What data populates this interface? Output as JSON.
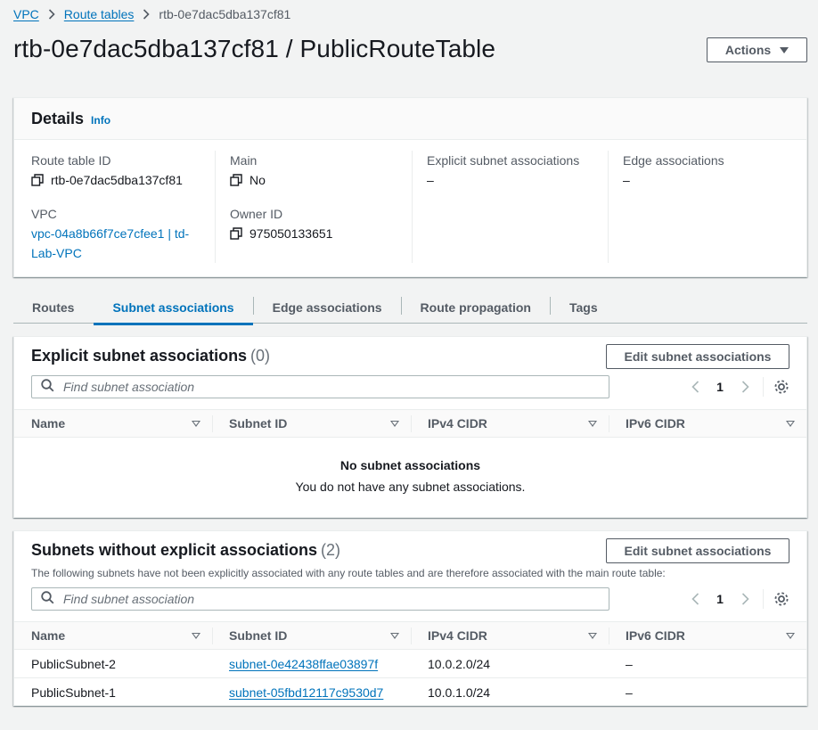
{
  "breadcrumb": {
    "items": [
      "VPC",
      "Route tables"
    ],
    "current": "rtb-0e7dac5dba137cf81"
  },
  "page": {
    "title": "rtb-0e7dac5dba137cf81 / PublicRouteTable",
    "actions_label": "Actions"
  },
  "details": {
    "title": "Details",
    "info": "Info",
    "route_table_id_label": "Route table ID",
    "route_table_id": "rtb-0e7dac5dba137cf81",
    "vpc_label": "VPC",
    "vpc_line1": "vpc-04a8b66f7ce7cfee1 | td-",
    "vpc_line2": "Lab-VPC",
    "main_label": "Main",
    "main_value": "No",
    "owner_label": "Owner ID",
    "owner_value": "975050133651",
    "explicit_label": "Explicit subnet associations",
    "explicit_value": "–",
    "edge_label": "Edge associations",
    "edge_value": "–"
  },
  "tabs": [
    "Routes",
    "Subnet associations",
    "Edge associations",
    "Route propagation",
    "Tags"
  ],
  "explicit": {
    "title": "Explicit subnet associations",
    "count": "(0)",
    "edit_label": "Edit subnet associations",
    "search_placeholder": "Find subnet association",
    "page": "1",
    "columns": [
      "Name",
      "Subnet ID",
      "IPv4 CIDR",
      "IPv6 CIDR"
    ],
    "empty_title": "No subnet associations",
    "empty_text": "You do not have any subnet associations."
  },
  "without": {
    "title": "Subnets without explicit associations",
    "count": "(2)",
    "edit_label": "Edit subnet associations",
    "description": "The following subnets have not been explicitly associated with any route tables and are therefore associated with the main route table:",
    "search_placeholder": "Find subnet association",
    "page": "1",
    "columns": [
      "Name",
      "Subnet ID",
      "IPv4 CIDR",
      "IPv6 CIDR"
    ],
    "rows": [
      {
        "name": "PublicSubnet-2",
        "subnet_id": "subnet-0e42438ffae03897f",
        "ipv4": "10.0.2.0/24",
        "ipv6": "–"
      },
      {
        "name": "PublicSubnet-1",
        "subnet_id": "subnet-05fbd12117c9530d7",
        "ipv4": "10.0.1.0/24",
        "ipv6": "–"
      }
    ]
  },
  "colors": {
    "link": "#0073bb",
    "text": "#16191f",
    "muted": "#545b64",
    "background": "#f2f3f3"
  }
}
